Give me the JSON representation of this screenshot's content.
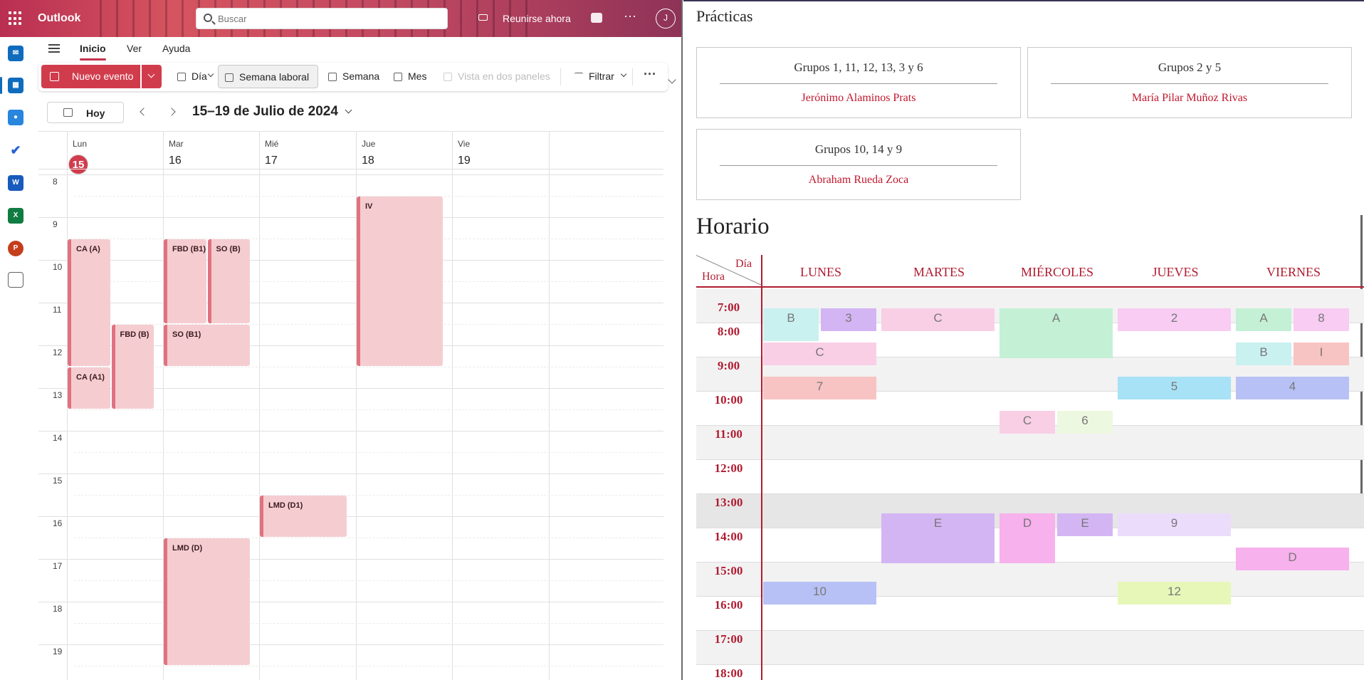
{
  "outlook": {
    "app_name": "Outlook",
    "search_placeholder": "Buscar",
    "meet_now": "Reunirse ahora",
    "more": "···",
    "avatar_initial": "J",
    "ribbon_tabs": [
      "Inicio",
      "Ver",
      "Ayuda"
    ],
    "toolbar": {
      "new_event": "Nuevo evento",
      "day": "Día",
      "work_week": "Semana laboral",
      "week": "Semana",
      "month": "Mes",
      "split_view": "Vista en dos paneles",
      "filter": "Filtrar",
      "more": "···"
    },
    "nav": {
      "today": "Hoy",
      "range": "15–19 de Julio de 2024"
    },
    "days": [
      {
        "name": "Lun",
        "num": "15",
        "today": true
      },
      {
        "name": "Mar",
        "num": "16",
        "today": false
      },
      {
        "name": "Mié",
        "num": "17",
        "today": false
      },
      {
        "name": "Jue",
        "num": "18",
        "today": false
      },
      {
        "name": "Vie",
        "num": "19",
        "today": false
      }
    ],
    "hours": [
      "8",
      "9",
      "10",
      "11",
      "12",
      "13",
      "14",
      "15",
      "16",
      "17",
      "18",
      "19"
    ],
    "events": [
      {
        "title": "CA (A)",
        "day": 0,
        "start": 9.5,
        "end": 12.5,
        "lane": 0,
        "lanes": 2
      },
      {
        "title": "CA (A1)",
        "day": 0,
        "start": 12.5,
        "end": 13.5,
        "lane": 0,
        "lanes": 2
      },
      {
        "title": "FBD (B)",
        "day": 0,
        "start": 11.5,
        "end": 13.5,
        "lane": 1,
        "lanes": 2
      },
      {
        "title": "FBD (B1)",
        "day": 1,
        "start": 9.5,
        "end": 11.5,
        "lane": 0,
        "lanes": 2
      },
      {
        "title": "SO (B)",
        "day": 1,
        "start": 9.5,
        "end": 11.5,
        "lane": 1,
        "lanes": 2
      },
      {
        "title": "SO (B1)",
        "day": 1,
        "start": 11.5,
        "end": 12.5,
        "lane": 0,
        "lanes": 1
      },
      {
        "title": "LMD (D)",
        "day": 1,
        "start": 16.5,
        "end": 19.5,
        "lane": 0,
        "lanes": 1
      },
      {
        "title": "LMD (D1)",
        "day": 2,
        "start": 15.5,
        "end": 16.5,
        "lane": 0,
        "lanes": 1
      },
      {
        "title": "IV",
        "day": 3,
        "start": 8.5,
        "end": 12.5,
        "lane": 0,
        "lanes": 1
      }
    ]
  },
  "doc": {
    "practicas_title": "Prácticas",
    "groups": [
      {
        "groups": "Grupos  1, 11, 12, 13, 3 y 6",
        "teacher": "Jerónimo Alaminos Prats"
      },
      {
        "groups": "Grupos  2 y 5",
        "teacher": "María Pilar Muñoz Rivas"
      },
      {
        "groups": "Grupos  10, 14 y 9",
        "teacher": "Abraham Rueda Zoca"
      }
    ],
    "horario_title": "Horario",
    "corner_day": "Día",
    "corner_hour": "Hora",
    "weekdays": [
      "LUNES",
      "MARTES",
      "MIÉRCOLES",
      "JUEVES",
      "VIERNES"
    ],
    "hours": [
      "7:00",
      "8:00",
      "9:00",
      "10:00",
      "11:00",
      "12:00",
      "13:00",
      "14:00",
      "15:00",
      "16:00",
      "17:00",
      "18:00"
    ],
    "blocks": [
      {
        "label": "B",
        "day": 0,
        "start": 9.0,
        "end": 10.0,
        "lane": 0,
        "lanes": 2,
        "color": "#c9f1f0"
      },
      {
        "label": "3",
        "day": 0,
        "start": 9.0,
        "end": 9.7,
        "lane": 1,
        "lanes": 2,
        "color": "#d4b5f4"
      },
      {
        "label": "C",
        "day": 0,
        "start": 10.0,
        "end": 10.7,
        "lane": 0,
        "lanes": 1,
        "color": "#f9cfe6"
      },
      {
        "label": "7",
        "day": 0,
        "start": 11.0,
        "end": 11.7,
        "lane": 0,
        "lanes": 1,
        "color": "#f8c3c3"
      },
      {
        "label": "10",
        "day": 0,
        "start": 17.0,
        "end": 17.7,
        "lane": 0,
        "lanes": 1,
        "color": "#b8c1f5"
      },
      {
        "label": "C",
        "day": 1,
        "start": 9.0,
        "end": 9.7,
        "lane": 0,
        "lanes": 1,
        "color": "#f9cfe6"
      },
      {
        "label": "E",
        "day": 1,
        "start": 15.0,
        "end": 16.5,
        "lane": 0,
        "lanes": 1,
        "color": "#d4b5f4"
      },
      {
        "label": "A",
        "day": 2,
        "start": 9.0,
        "end": 10.5,
        "lane": 0,
        "lanes": 1,
        "color": "#c4f0d6"
      },
      {
        "label": "C",
        "day": 2,
        "start": 12.0,
        "end": 12.7,
        "lane": 0,
        "lanes": 2,
        "color": "#f9cfe6"
      },
      {
        "label": "6",
        "day": 2,
        "start": 12.0,
        "end": 12.7,
        "lane": 1,
        "lanes": 2,
        "color": "#edf8e0"
      },
      {
        "label": "D",
        "day": 2,
        "start": 15.0,
        "end": 16.5,
        "lane": 0,
        "lanes": 2,
        "color": "#f7b1ec"
      },
      {
        "label": "E",
        "day": 2,
        "start": 15.0,
        "end": 15.7,
        "lane": 1,
        "lanes": 2,
        "color": "#d4b5f4"
      },
      {
        "label": "2",
        "day": 3,
        "start": 9.0,
        "end": 9.7,
        "lane": 0,
        "lanes": 1,
        "color": "#f8ccf3"
      },
      {
        "label": "5",
        "day": 3,
        "start": 11.0,
        "end": 11.7,
        "lane": 0,
        "lanes": 1,
        "color": "#a8e2f6"
      },
      {
        "label": "9",
        "day": 3,
        "start": 15.0,
        "end": 15.7,
        "lane": 0,
        "lanes": 1,
        "color": "#ecdcfb"
      },
      {
        "label": "12",
        "day": 3,
        "start": 17.0,
        "end": 17.7,
        "lane": 0,
        "lanes": 1,
        "color": "#e6f7b8"
      },
      {
        "label": "A",
        "day": 4,
        "start": 9.0,
        "end": 9.7,
        "lane": 0,
        "lanes": 2,
        "color": "#c4f0d6"
      },
      {
        "label": "8",
        "day": 4,
        "start": 9.0,
        "end": 9.7,
        "lane": 1,
        "lanes": 2,
        "color": "#f8ccf3"
      },
      {
        "label": "B",
        "day": 4,
        "start": 10.0,
        "end": 10.7,
        "lane": 0,
        "lanes": 2,
        "color": "#c9f1f0"
      },
      {
        "label": "I",
        "day": 4,
        "start": 10.0,
        "end": 10.7,
        "lane": 1,
        "lanes": 2,
        "color": "#f8c3c3"
      },
      {
        "label": "4",
        "day": 4,
        "start": 11.0,
        "end": 11.7,
        "lane": 0,
        "lanes": 1,
        "color": "#b8c1f5"
      },
      {
        "label": "D",
        "day": 4,
        "start": 16.0,
        "end": 16.7,
        "lane": 0,
        "lanes": 1,
        "color": "#f7b1ec"
      }
    ]
  },
  "colors": {
    "outlook_accent": "#d13c4c",
    "event_fill": "#f5cdd1",
    "doc_red": "#b01c31"
  },
  "icons": {
    "rail": [
      "mail-icon",
      "calendar-icon",
      "people-icon",
      "todo-icon",
      "word-icon",
      "excel-icon",
      "powerpoint-icon",
      "apps-icon"
    ]
  }
}
